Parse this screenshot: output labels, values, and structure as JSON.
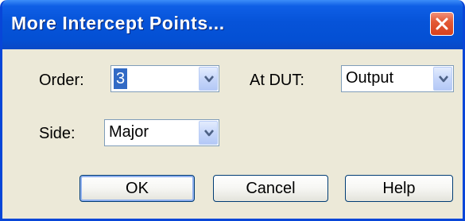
{
  "window": {
    "title": "More Intercept Points...",
    "close_icon": "close-icon"
  },
  "form": {
    "order": {
      "label": "Order:",
      "value": "3"
    },
    "at_dut": {
      "label": "At DUT:",
      "value": "Output"
    },
    "side": {
      "label": "Side:",
      "value": "Major"
    }
  },
  "buttons": {
    "ok": "OK",
    "cancel": "Cancel",
    "help": "Help"
  },
  "colors": {
    "titlebar": "#0553d6",
    "dialog_bg": "#ece9d8",
    "selection": "#316ac5",
    "close_button": "#d7401c"
  }
}
